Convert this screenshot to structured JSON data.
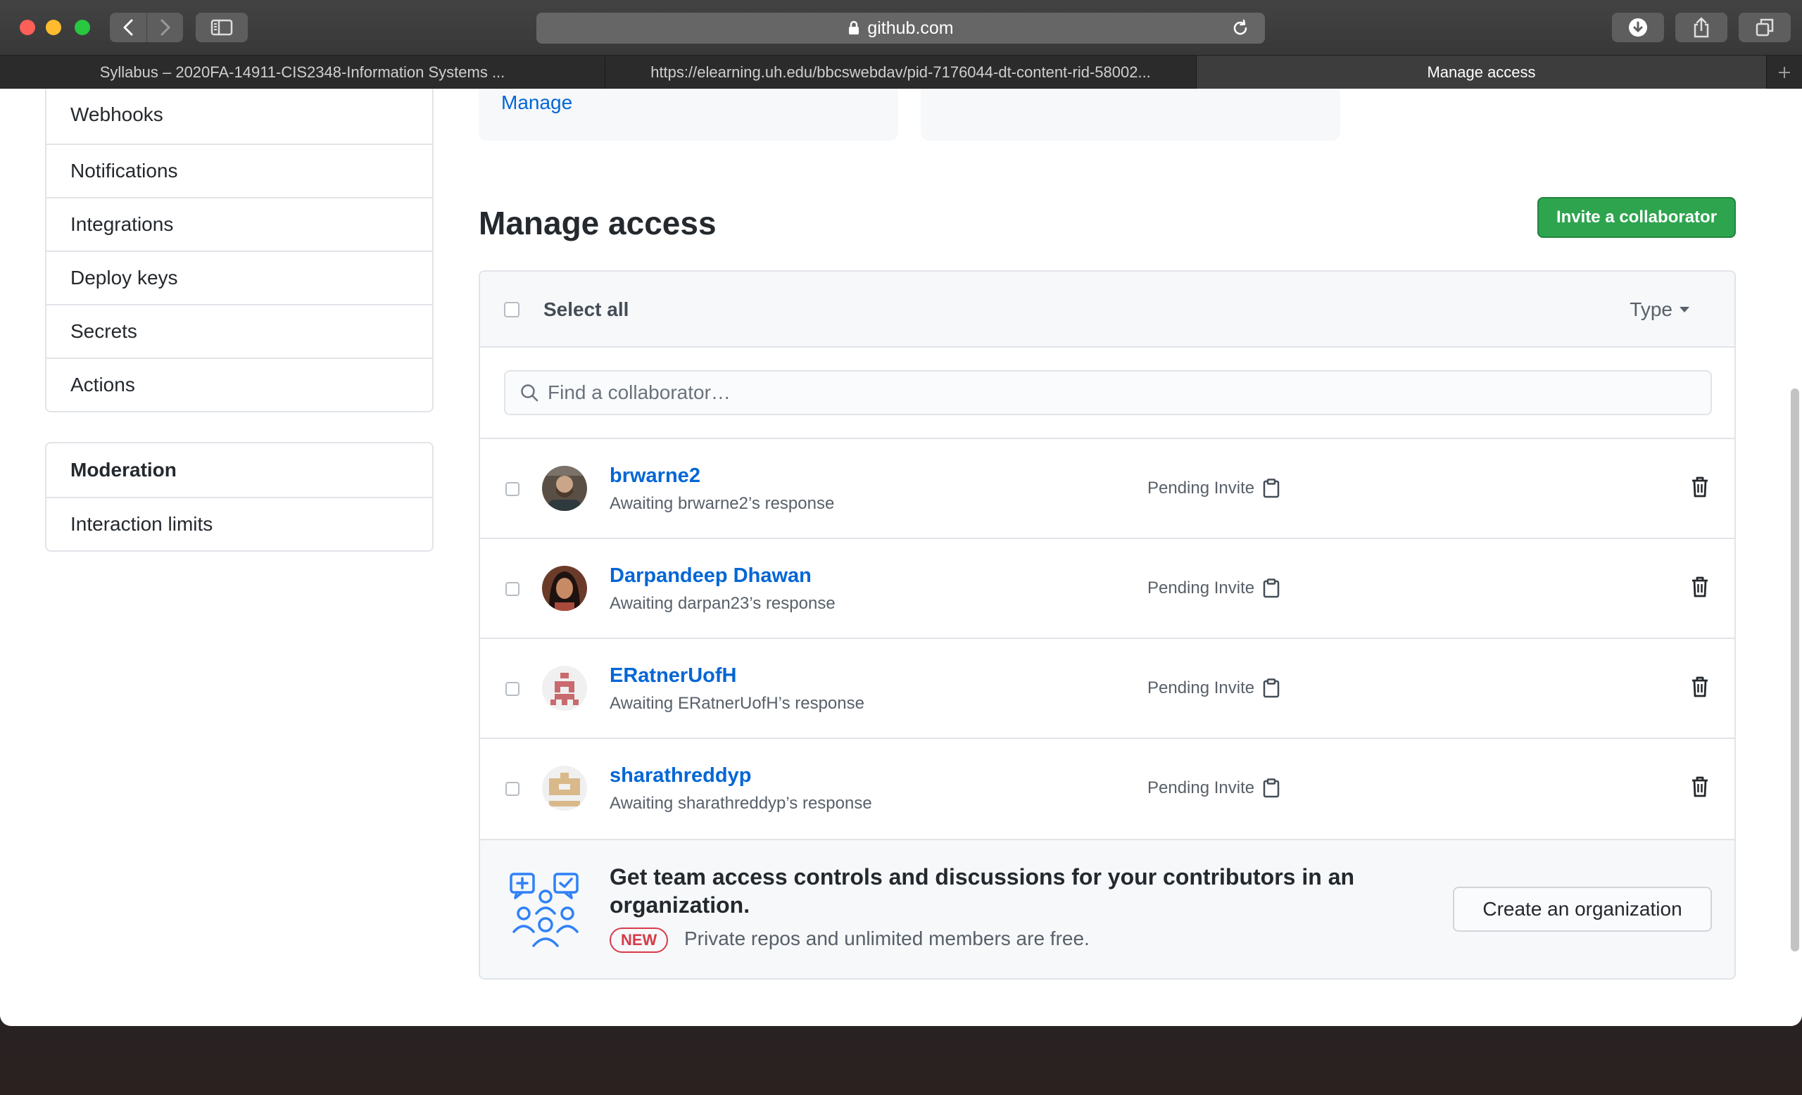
{
  "browser": {
    "url": "github.com",
    "tabs": [
      {
        "label": "Syllabus – 2020FA-14911-CIS2348-Information Systems ..."
      },
      {
        "label": "https://elearning.uh.edu/bbcswebdav/pid-7176044-dt-content-rid-58002..."
      },
      {
        "label": "Manage access"
      }
    ]
  },
  "sidebar": {
    "group1": [
      {
        "label": "Webhooks"
      },
      {
        "label": "Notifications"
      },
      {
        "label": "Integrations"
      },
      {
        "label": "Deploy keys"
      },
      {
        "label": "Secrets"
      },
      {
        "label": "Actions"
      }
    ],
    "group2": {
      "header": "Moderation",
      "items": [
        {
          "label": "Interaction limits"
        }
      ]
    }
  },
  "top_card": {
    "manage_link": "Manage"
  },
  "main": {
    "title": "Manage access",
    "invite_button": "Invite a collaborator",
    "select_all": "Select all",
    "type_filter": "Type",
    "search_placeholder": "Find a collaborator…",
    "collaborators": [
      {
        "name": "brwarne2",
        "status": "Awaiting brwarne2’s response",
        "invite": "Pending Invite"
      },
      {
        "name": "Darpandeep Dhawan",
        "status": "Awaiting darpan23’s response",
        "invite": "Pending Invite"
      },
      {
        "name": "ERatnerUofH",
        "status": "Awaiting ERatnerUofH’s response",
        "invite": "Pending Invite"
      },
      {
        "name": "sharathreddyp",
        "status": "Awaiting sharathreddyp’s response",
        "invite": "Pending Invite"
      }
    ],
    "promo": {
      "title": "Get team access controls and discussions for your contributors in an organization.",
      "badge": "NEW",
      "subtitle": "Private repos and unlimited members are free.",
      "button": "Create an organization"
    }
  },
  "colors": {
    "link": "#0366d6",
    "primary_button": "#2ea44f",
    "new_badge": "#d73a49"
  }
}
